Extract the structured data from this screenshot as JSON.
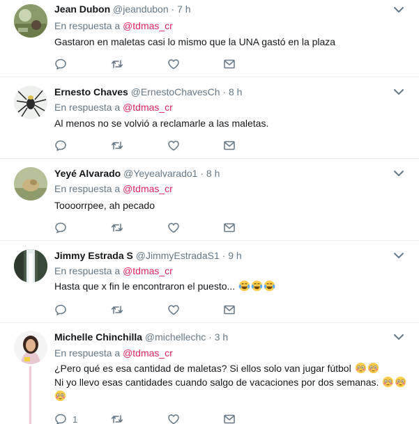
{
  "reply_prefix": "En respuesta a",
  "colors": {
    "mention": "#e0245e",
    "meta": "#657786",
    "border": "#e6ecf0",
    "thread_line": "#f5c6d6"
  },
  "icons": {
    "caret": "chevron-down-icon",
    "reply": "reply-icon",
    "retweet": "retweet-icon",
    "like": "heart-icon",
    "dm": "envelope-icon"
  },
  "tweets": [
    {
      "name": "Jean Dubon",
      "handle": "@jeandubon",
      "time": "7 h",
      "mention": "@tdmas_cr",
      "lines": [
        "Gastaron en maletas casi lo mismo que la UNA gastó en la plaza"
      ]
    },
    {
      "name": "Ernesto Chaves",
      "handle": "@ErnestoChavesCh",
      "time": "8 h",
      "mention": "@tdmas_cr",
      "lines": [
        "Al menos no se volvió a reclamarle a las maletas."
      ]
    },
    {
      "name": "Yeyé Alvarado",
      "handle": "@Yeyealvarado1",
      "time": "8 h",
      "mention": "@tdmas_cr",
      "lines": [
        "Toooorrpee, ah pecado"
      ]
    },
    {
      "name": "Jimmy Estrada S",
      "handle": "@JimmyEstradaS1",
      "time": "9 h",
      "mention": "@tdmas_cr",
      "lines": [
        "Hasta que x fin le encontraron el puesto..."
      ],
      "emoji": [
        "tears-of-joy",
        "tears-of-joy",
        "tears-of-joy"
      ]
    },
    {
      "name": "Michelle Chinchilla",
      "handle": "@michellechc",
      "time": "3 h",
      "mention": "@tdmas_cr",
      "lines": [
        "¿Pero qué es esa cantidad de maletas? Si ellos solo van jugar fútbol",
        "Ni yo llevo esas cantidades cuando salgo de vacaciones por dos semanas."
      ],
      "emoji": [
        "flushed",
        "flushed",
        "flushed",
        "flushed",
        "flushed"
      ],
      "reply_count": "1"
    }
  ]
}
